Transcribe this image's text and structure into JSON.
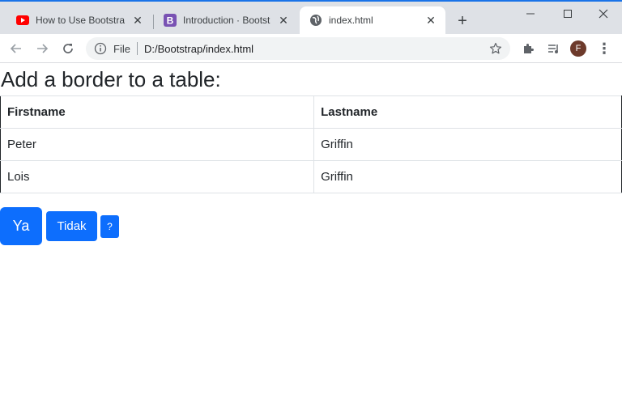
{
  "browser": {
    "tabs": [
      {
        "title": "How to Use Bootstrap",
        "icon": "youtube-icon",
        "active": false
      },
      {
        "title": "Introduction · Bootstrap",
        "icon": "bootstrap-icon",
        "active": false
      },
      {
        "title": "index.html",
        "icon": "globe-icon",
        "active": true
      }
    ],
    "new_tab_symbol": "+",
    "window_controls": {
      "minimize": "—",
      "maximize": "☐",
      "close": "✕"
    },
    "toolbar": {
      "back": "←",
      "forward": "→",
      "reload": "C",
      "info_icon": "i",
      "scheme": "File",
      "url": "D:/Bootstrap/index.html",
      "avatar_letter": "F",
      "menu": "⋮"
    }
  },
  "page": {
    "heading": "Add a border to a table:",
    "table": {
      "headers": [
        "Firstname",
        "Lastname"
      ],
      "rows": [
        [
          "Peter",
          "Griffin"
        ],
        [
          "Lois",
          "Griffin"
        ]
      ]
    },
    "buttons": {
      "ya": "Ya",
      "tidak": "Tidak",
      "question": "?"
    }
  },
  "colors": {
    "primary": "#0d6efd",
    "text": "#212529",
    "border_light": "#dee2e6",
    "tab_strip": "#dee1e6",
    "youtube_red": "#ff0000",
    "bootstrap_purple": "#7952b3"
  }
}
